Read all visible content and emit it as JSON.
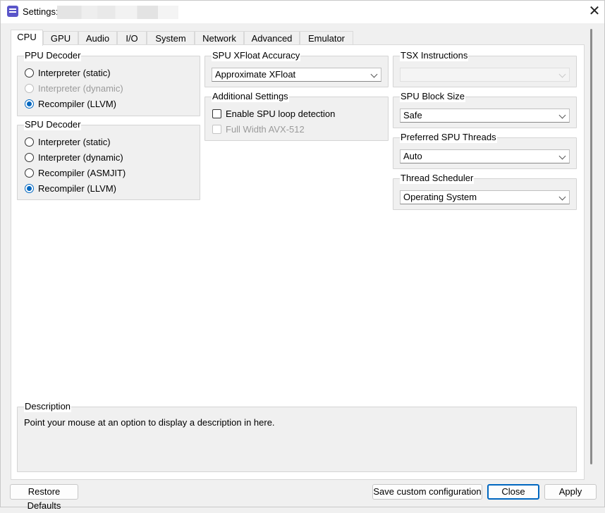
{
  "window": {
    "title": "Settings:",
    "close_glyph": "✕",
    "app_icon": "list-icon"
  },
  "tabs": [
    {
      "label": "CPU",
      "active": true
    },
    {
      "label": "GPU"
    },
    {
      "label": "Audio"
    },
    {
      "label": "I/O"
    },
    {
      "label": "System"
    },
    {
      "label": "Network"
    },
    {
      "label": "Advanced"
    },
    {
      "label": "Emulator"
    }
  ],
  "ppu_decoder": {
    "title": "PPU Decoder",
    "options": [
      "Interpreter (static)",
      "Interpreter (dynamic)",
      "Recompiler (LLVM)"
    ],
    "selected": "Recompiler (LLVM)"
  },
  "spu_decoder": {
    "title": "SPU Decoder",
    "options": [
      "Interpreter (static)",
      "Interpreter (dynamic)",
      "Recompiler (ASMJIT)",
      "Recompiler (LLVM)"
    ],
    "selected": "Recompiler (LLVM)"
  },
  "spu_xfloat": {
    "title": "SPU XFloat Accuracy",
    "value": "Approximate XFloat"
  },
  "additional": {
    "title": "Additional Settings",
    "spu_loop_detection": "Enable SPU loop detection",
    "avx512": "Full Width AVX-512"
  },
  "tsx": {
    "title": "TSX Instructions",
    "value": ""
  },
  "spu_block_size": {
    "title": "SPU Block Size",
    "value": "Safe"
  },
  "preferred_spu_threads": {
    "title": "Preferred SPU Threads",
    "value": "Auto"
  },
  "thread_scheduler": {
    "title": "Thread Scheduler",
    "value": "Operating System"
  },
  "description": {
    "title": "Description",
    "text": "Point your mouse at an option to display a description in here."
  },
  "buttons": {
    "restore": "Restore Defaults",
    "save_custom": "Save custom configuration",
    "close": "Close",
    "apply": "Apply"
  },
  "colors": {
    "accent": "#0067c0",
    "panel": "#ffffff",
    "window": "#f0f0f0"
  }
}
